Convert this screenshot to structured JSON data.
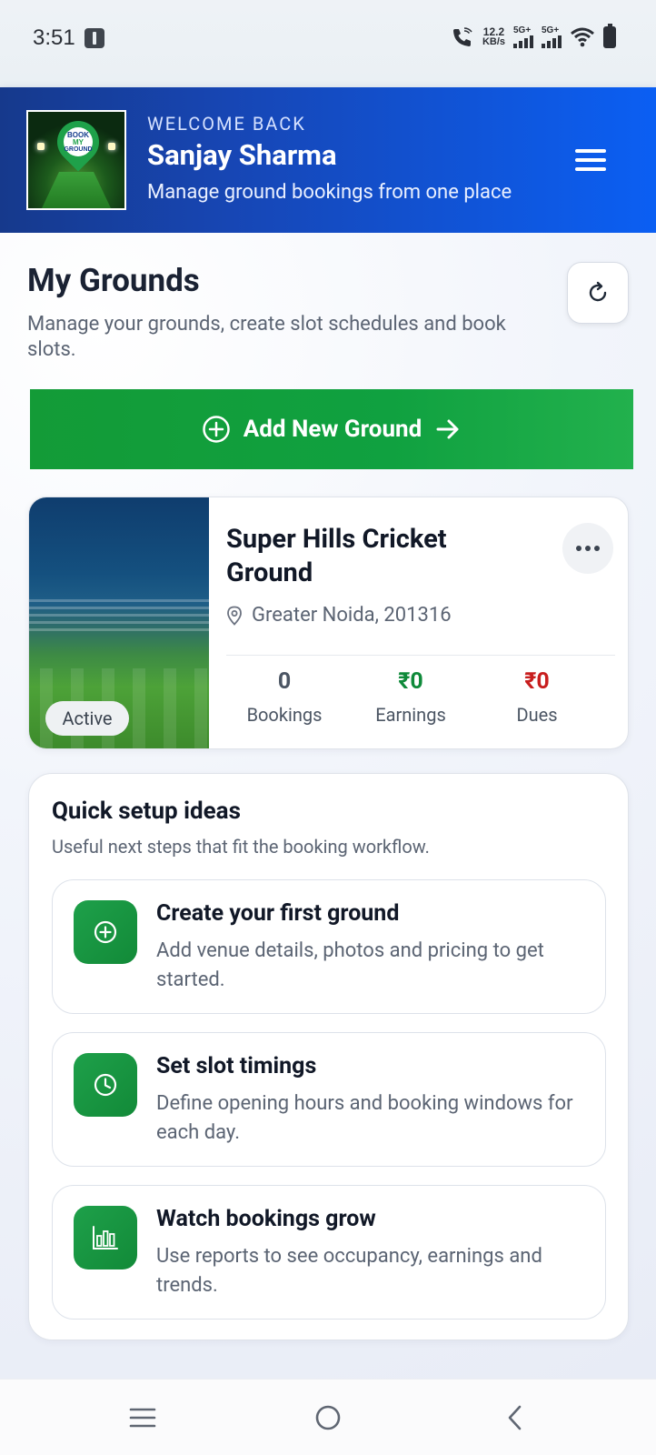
{
  "status_bar": {
    "time": "3:51",
    "net_speed_value": "12.2",
    "net_speed_unit": "KB/s",
    "sim1_label": "5G+",
    "sim2_label": "5G+"
  },
  "header": {
    "logo_line1": "BOOK",
    "logo_line2": "MY",
    "logo_line3": "GROUND",
    "welcome": "WELCOME BACK",
    "user_name": "Sanjay Sharma",
    "tagline": "Manage ground bookings from one place",
    "menu_icon": "hamburger-menu-icon"
  },
  "page": {
    "title": "My Grounds",
    "subtitle": "Manage your grounds, create slot schedules and book slots.",
    "refresh_icon": "refresh-icon"
  },
  "add_button": {
    "label": "Add New Ground",
    "leading_icon": "plus-circle-icon",
    "trailing_icon": "arrow-right-icon",
    "color": "#139b37"
  },
  "ground": {
    "name": "Super Hills Cricket Ground",
    "status": "Active",
    "location": "Greater Noida, 201316",
    "stats": [
      {
        "value": "0",
        "label": "Bookings",
        "color": "#4b5563"
      },
      {
        "value": "₹0",
        "label": "Earnings",
        "color": "#0f8a3a"
      },
      {
        "value": "₹0",
        "label": "Dues",
        "color": "#c81e1e"
      }
    ]
  },
  "ideas": {
    "title": "Quick setup ideas",
    "subtitle": "Useful next steps that fit the booking workflow.",
    "items": [
      {
        "title": "Create your first ground",
        "desc": "Add venue details, photos and pricing to get started.",
        "icon": "plus-circle-icon"
      },
      {
        "title": "Set slot timings",
        "desc": "Define opening hours and booking windows for each day.",
        "icon": "clock-icon"
      },
      {
        "title": "Watch bookings grow",
        "desc": "Use reports to see occupancy, earnings and trends.",
        "icon": "bar-chart-icon"
      }
    ]
  },
  "colors": {
    "header_start": "#16398c",
    "header_end": "#0b5ff3",
    "brand_green": "#139b37",
    "earnings_green": "#0f8a3a",
    "dues_red": "#c81e1e"
  }
}
